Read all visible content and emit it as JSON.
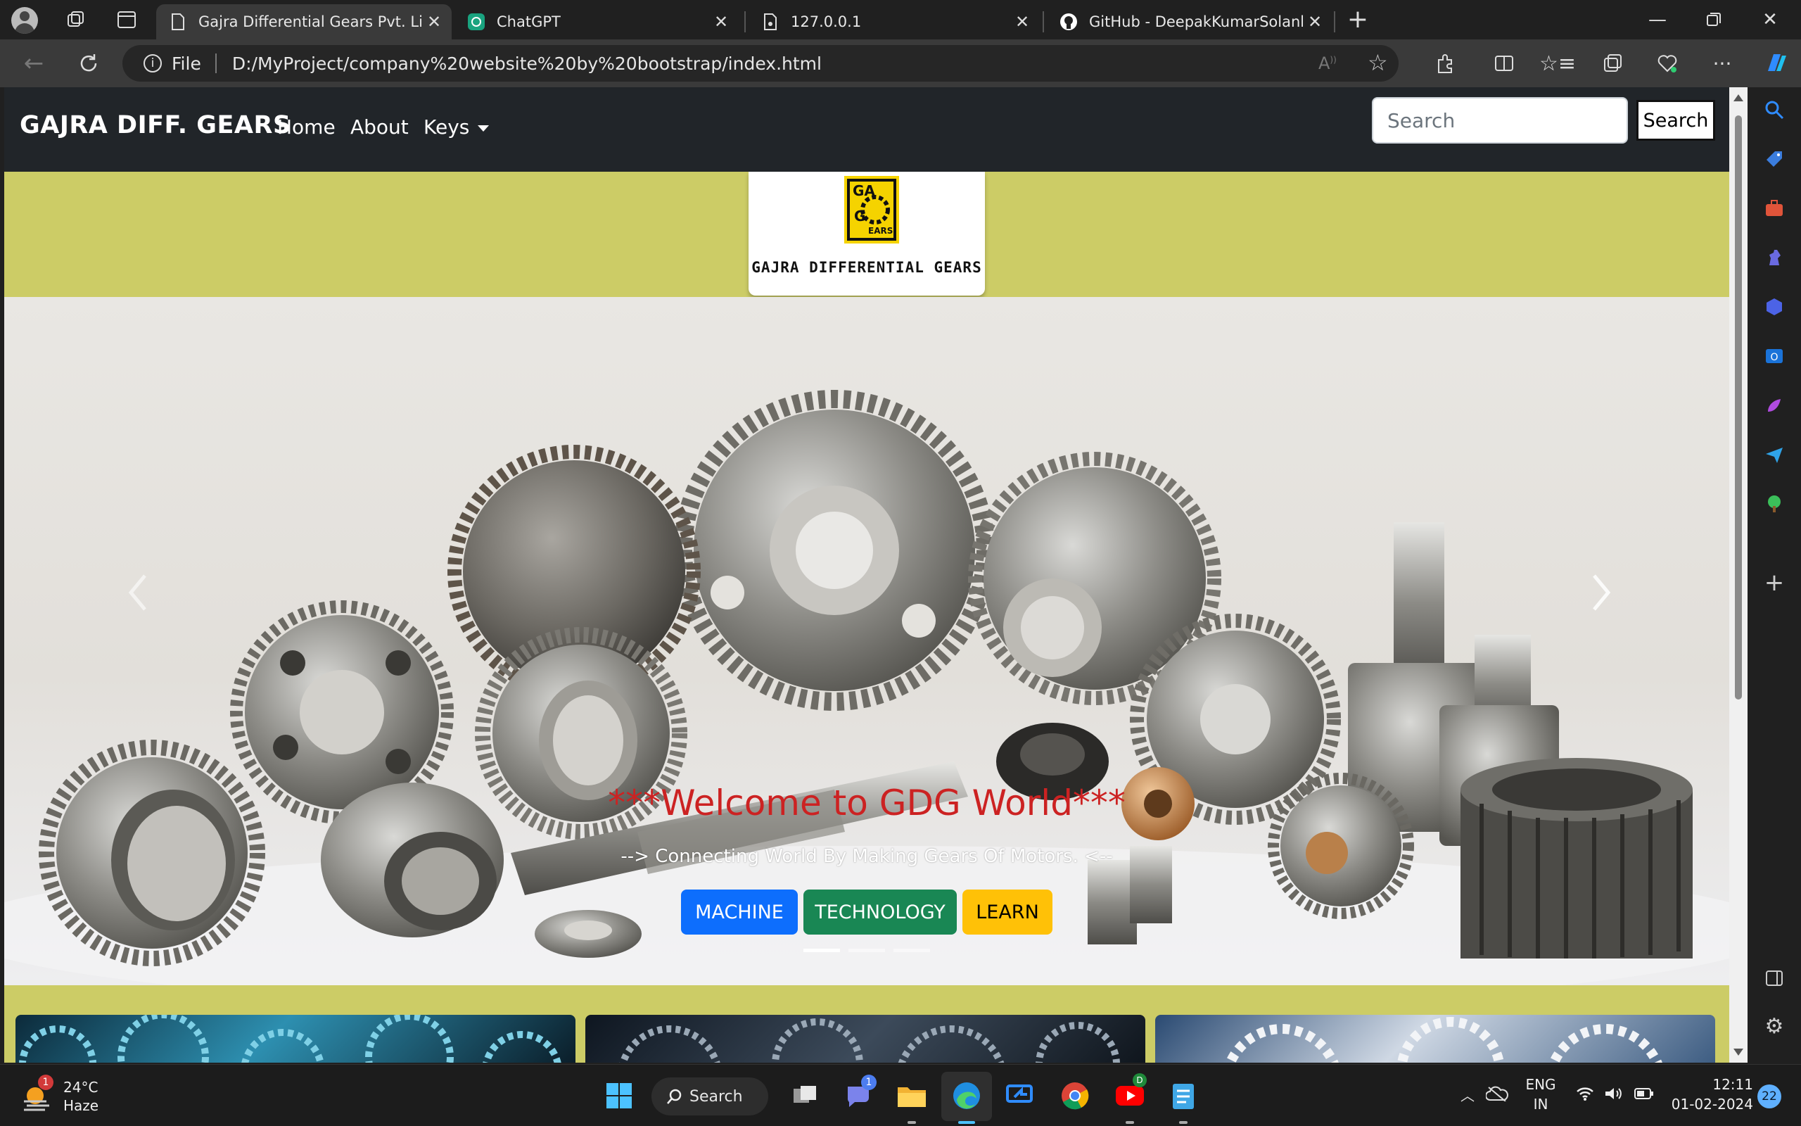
{
  "browser": {
    "tabs": [
      {
        "title": "Gajra Differential Gears Pvt. Limit",
        "active": true
      },
      {
        "title": "ChatGPT",
        "active": false
      },
      {
        "title": "127.0.0.1",
        "active": false
      },
      {
        "title": "GitHub - DeepakKumarSolanki/A",
        "active": false
      }
    ],
    "address": {
      "scheme_label": "File",
      "url": "D:/MyProject/company%20website%20by%20bootstrap/index.html"
    }
  },
  "site": {
    "brand": "GAJRA DIFF. GEARS",
    "nav": {
      "home": "Home",
      "about": "About",
      "keys": "Keys"
    },
    "search": {
      "placeholder": "Search",
      "button": "Search"
    },
    "logo": {
      "mark_text": "GAJRA GEARS",
      "caption": "GAJRA DIFFERENTIAL GEARS"
    },
    "carousel": {
      "title": "***Welcome to GDG World***",
      "subtitle": "--> Connecting World By Making Gears Of Motors. <--",
      "buttons": {
        "machine": "MACHINE",
        "technology": "TECHNOLOGY",
        "learn": "LEARN"
      },
      "slide_count": 3,
      "active_slide": 1
    },
    "colors": {
      "navbar": "#212529",
      "band": "#cccc66",
      "primary": "#0d6efd",
      "success": "#198754",
      "warning": "#ffc107",
      "caption_title": "#cc2222"
    }
  },
  "taskbar": {
    "weather": {
      "temp": "24°C",
      "condition": "Haze",
      "badge": "1"
    },
    "search_label": "Search",
    "teams_badge": "1",
    "youtube_badge": "D",
    "language": {
      "line1": "ENG",
      "line2": "IN"
    },
    "clock": {
      "time": "12:11",
      "date": "01-02-2024"
    },
    "notifications": "22"
  }
}
